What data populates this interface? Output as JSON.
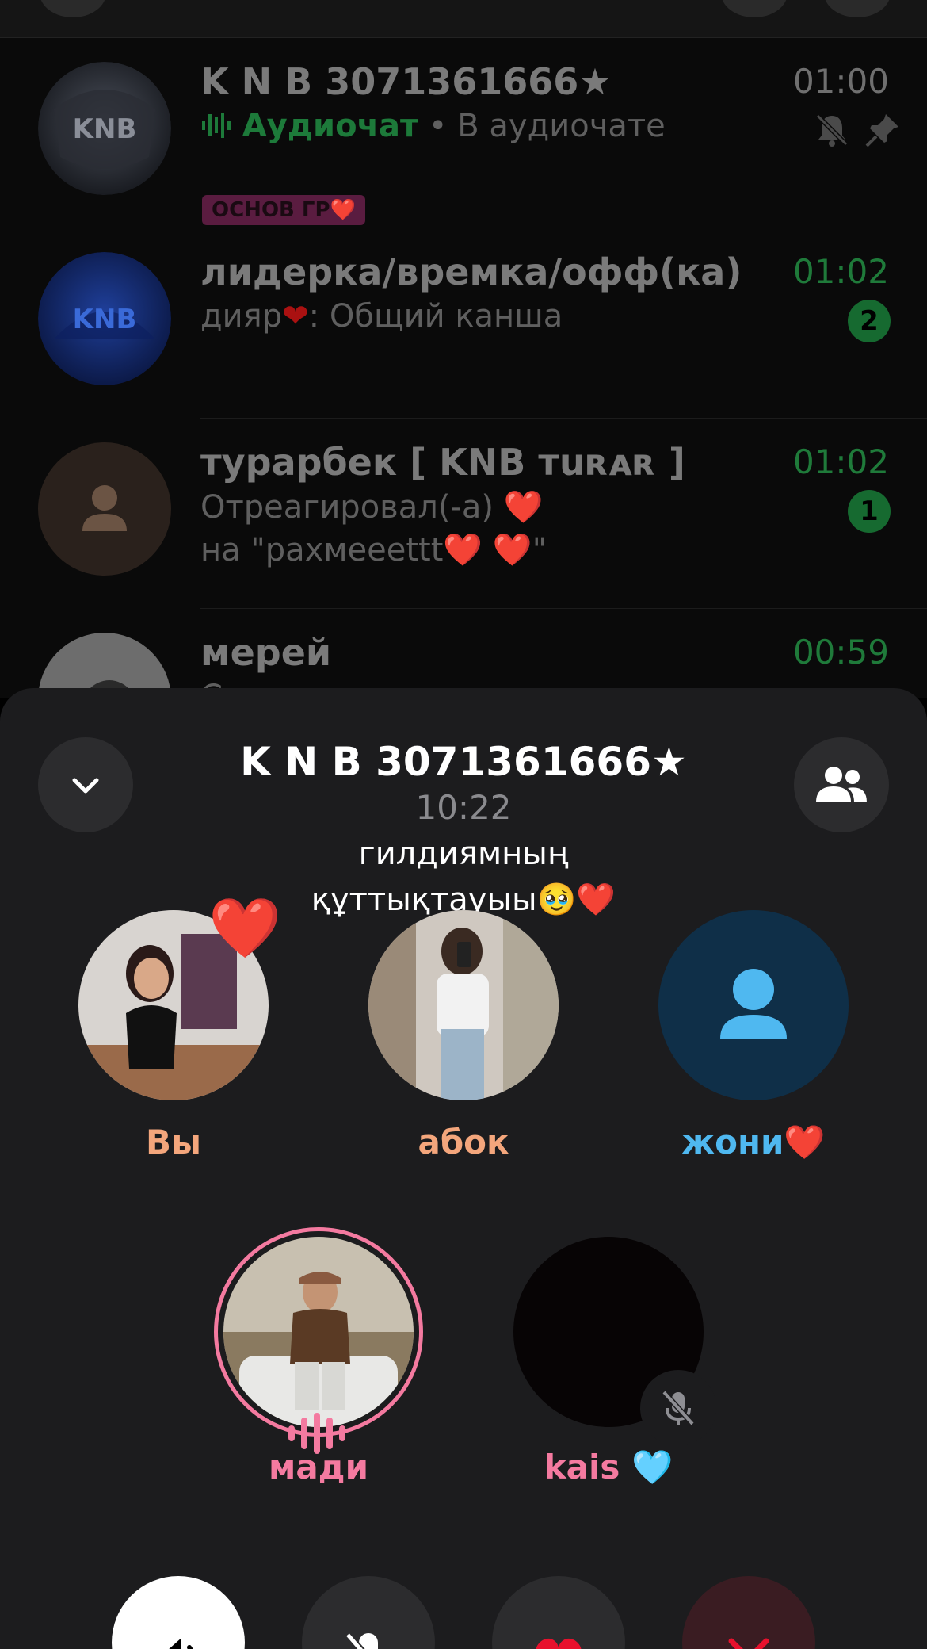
{
  "chat_list": {
    "chats": [
      {
        "title": "K N B 3071361666★",
        "time": "01:00",
        "line1_label": "Аудиочат",
        "line1_rest": " • В аудиочате",
        "tag": "ОСНОВ ГР❤️"
      },
      {
        "title": "лидерка/времка/офф(ка)",
        "time": "01:02",
        "sender": "дияр",
        "message": ": Общий канша",
        "unread": "2"
      },
      {
        "title": "турарбек [ KNB ᴛuʀᴀʀ ]",
        "time": "01:02",
        "line1": "Отреагировал(-а) ❤️",
        "line2": "на \"рахмееettt❤️ ❤️\"",
        "unread": "1"
      },
      {
        "title": "мерей",
        "time": "00:59",
        "message": "Стикер"
      }
    ]
  },
  "call": {
    "title": "K N B 3071361666★",
    "timer": "10:22",
    "status_line1": "гилдиямның",
    "status_line2": "құттықтауыы🥹❤️",
    "participants": [
      {
        "name": "Вы",
        "reaction": "❤️"
      },
      {
        "name": "абок"
      },
      {
        "name": "жони❤️"
      },
      {
        "name": "мади"
      },
      {
        "name": "kais 🩵"
      }
    ]
  },
  "colors": {
    "sheet_bg": "#1c1c1e",
    "name_orange": "#f4a67c",
    "name_blue": "#4fb8f0",
    "name_pink": "#f47aa0",
    "end_call_red": "#e8112d"
  }
}
